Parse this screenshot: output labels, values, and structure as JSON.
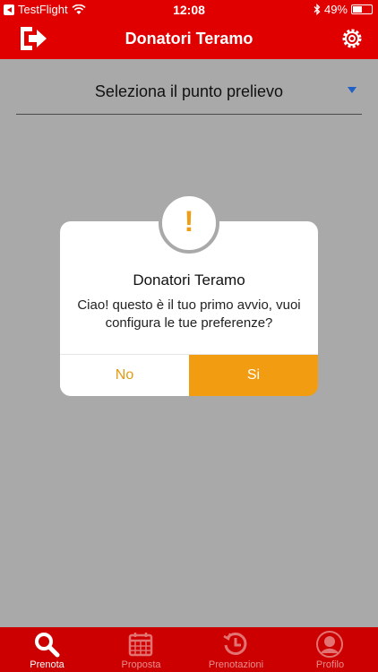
{
  "status_bar": {
    "carrier": "TestFlight",
    "time": "12:08",
    "battery_text": "49%",
    "battery_level": 0.49
  },
  "nav": {
    "title": "Donatori Teramo",
    "exit_icon": "exit-icon",
    "settings_icon": "gear-icon"
  },
  "picker": {
    "label": "Seleziona il punto prelievo"
  },
  "dialog": {
    "badge": "!",
    "title": "Donatori Teramo",
    "message": "Ciao! questo è il tuo primo avvio, vuoi configura le tue preferenze?",
    "no_label": "No",
    "yes_label": "Si"
  },
  "tabs": [
    {
      "label": "Prenota",
      "icon": "search-icon",
      "active": true
    },
    {
      "label": "Proposta",
      "icon": "calendar-icon",
      "active": false
    },
    {
      "label": "Prenotazioni",
      "icon": "history-icon",
      "active": false
    },
    {
      "label": "Profilo",
      "icon": "profile-icon",
      "active": false
    }
  ],
  "colors": {
    "brand": "#e00000",
    "accent": "#f29c11",
    "overlay": "#a9a9a9"
  }
}
